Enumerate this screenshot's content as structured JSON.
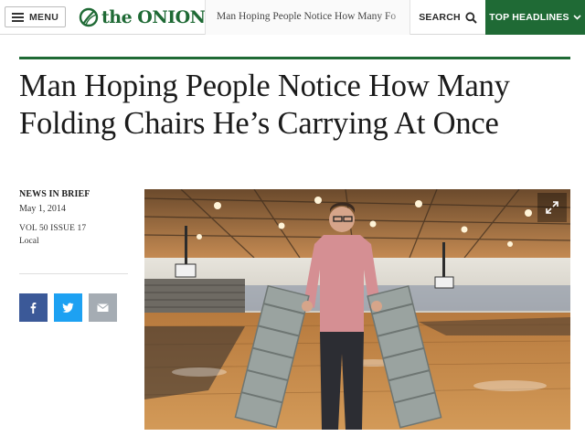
{
  "header": {
    "menu_label": "MENU",
    "logo_text": "the ONION",
    "article_title_strip": "Man Hoping People Notice How Many Fo",
    "search_label": "SEARCH",
    "top_headlines_label": "TOP HEADLINES",
    "brand_color": "#1f6a35"
  },
  "article": {
    "headline": "Man Hoping People Notice How Many Folding Chairs He’s Carrying At Once",
    "kicker": "NEWS IN BRIEF",
    "date": "May 1, 2014",
    "volume": "VOL 50 ISSUE 17",
    "section": "Local",
    "share": [
      {
        "network": "facebook",
        "icon": "facebook-icon",
        "color": "#3b5998"
      },
      {
        "network": "twitter",
        "icon": "twitter-icon",
        "color": "#1da1f2"
      },
      {
        "network": "email",
        "icon": "email-icon",
        "color": "#a5acb3"
      }
    ],
    "image": {
      "subject": "man in pink shirt holding stacks of folding chairs in a school gymnasium",
      "expand_icon": "expand-icon"
    }
  }
}
